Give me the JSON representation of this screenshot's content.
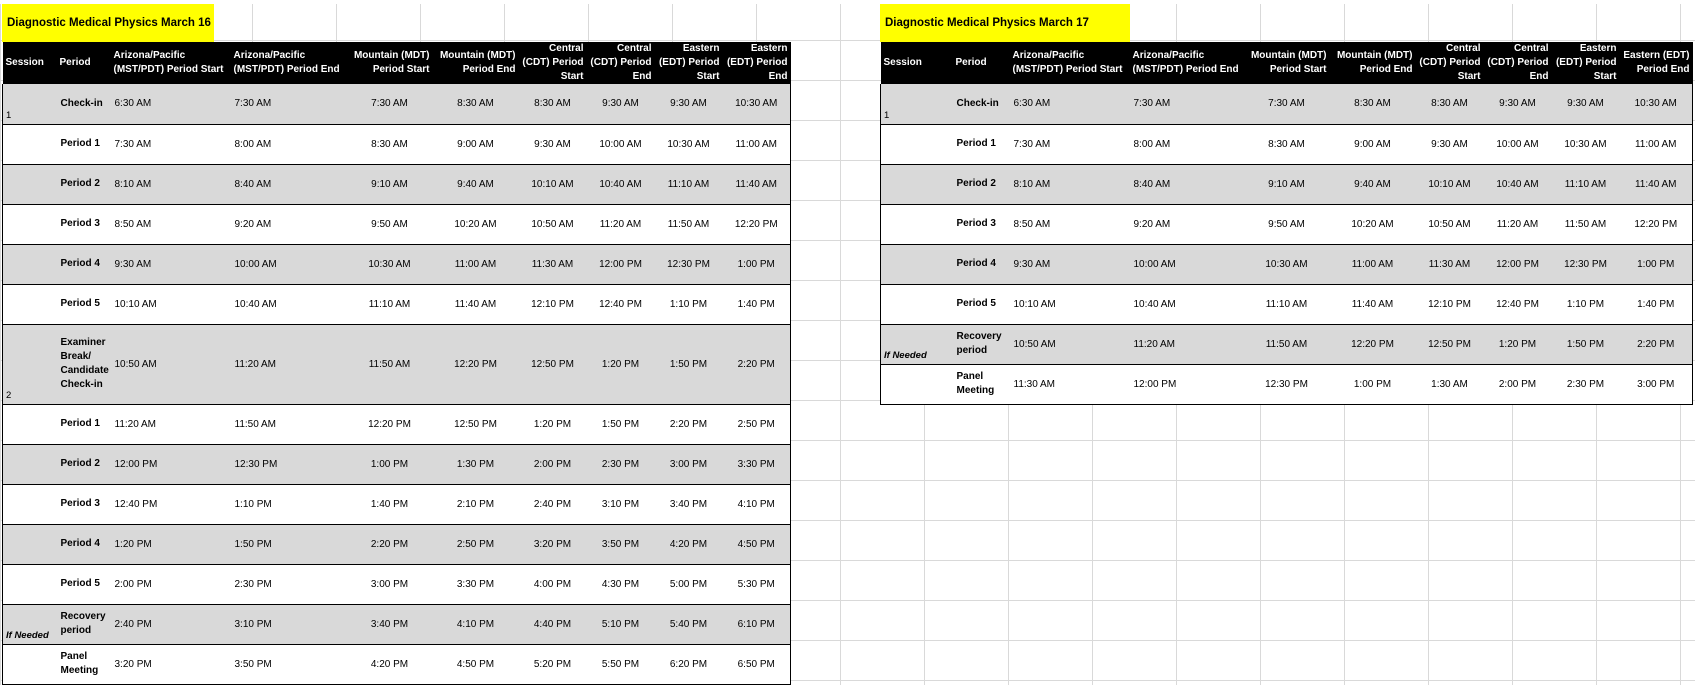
{
  "left": {
    "title": "Diagnostic Medical Physics March 16",
    "headers": [
      "Session",
      "Period",
      "Arizona/Pacific (MST/PDT) Period Start",
      "Arizona/Pacific (MST/PDT) Period End",
      "Mountain (MDT) Period Start",
      "Mountain (MDT) Period  End",
      "Central (CDT) Period Start",
      "Central (CDT) Period End",
      "Eastern (EDT) Period Start",
      "Eastern (EDT) Period End"
    ],
    "rows": [
      {
        "session": "1",
        "period": "Check-in",
        "times": [
          "6:30 AM",
          "7:30 AM",
          "7:30 AM",
          "8:30 AM",
          "8:30 AM",
          "9:30 AM",
          "9:30 AM",
          "10:30 AM"
        ]
      },
      {
        "session": "",
        "period": "Period 1",
        "times": [
          "7:30 AM",
          "8:00 AM",
          "8:30 AM",
          "9:00 AM",
          "9:30 AM",
          "10:00 AM",
          "10:30 AM",
          "11:00 AM"
        ]
      },
      {
        "session": "",
        "period": "Period 2",
        "times": [
          "8:10 AM",
          "8:40 AM",
          "9:10 AM",
          "9:40 AM",
          "10:10 AM",
          "10:40 AM",
          "11:10 AM",
          "11:40 AM"
        ]
      },
      {
        "session": "",
        "period": "Period 3",
        "times": [
          "8:50 AM",
          "9:20 AM",
          "9:50 AM",
          "10:20 AM",
          "10:50 AM",
          "11:20 AM",
          "11:50 AM",
          "12:20 PM"
        ]
      },
      {
        "session": "",
        "period": "Period 4",
        "times": [
          "9:30 AM",
          "10:00 AM",
          "10:30 AM",
          "11:00 AM",
          "11:30 AM",
          "12:00 PM",
          "12:30 PM",
          "1:00 PM"
        ]
      },
      {
        "session": "",
        "period": "Period 5",
        "times": [
          "10:10 AM",
          "10:40 AM",
          "11:10 AM",
          "11:40 AM",
          "12:10 PM",
          "12:40 PM",
          "1:10 PM",
          "1:40 PM"
        ]
      },
      {
        "session": "2",
        "period": "Examiner Break/ Candidate Check-in",
        "times": [
          "10:50 AM",
          "11:20 AM",
          "11:50 AM",
          "12:20 PM",
          "12:50 PM",
          "1:20 PM",
          "1:50 PM",
          "2:20 PM"
        ]
      },
      {
        "session": "",
        "period": "Period 1",
        "times": [
          "11:20 AM",
          "11:50 AM",
          "12:20 PM",
          "12:50 PM",
          "1:20 PM",
          "1:50 PM",
          "2:20 PM",
          "2:50 PM"
        ]
      },
      {
        "session": "",
        "period": "Period 2",
        "times": [
          "12:00 PM",
          "12:30 PM",
          "1:00 PM",
          "1:30 PM",
          "2:00 PM",
          "2:30 PM",
          "3:00 PM",
          "3:30 PM"
        ]
      },
      {
        "session": "",
        "period": "Period 3",
        "times": [
          "12:40 PM",
          "1:10 PM",
          "1:40 PM",
          "2:10 PM",
          "2:40 PM",
          "3:10 PM",
          "3:40 PM",
          "4:10 PM"
        ]
      },
      {
        "session": "",
        "period": "Period 4",
        "times": [
          "1:20 PM",
          "1:50 PM",
          "2:20 PM",
          "2:50 PM",
          "3:20 PM",
          "3:50 PM",
          "4:20 PM",
          "4:50 PM"
        ]
      },
      {
        "session": "",
        "period": "Period 5",
        "times": [
          "2:00 PM",
          "2:30 PM",
          "3:00 PM",
          "3:30 PM",
          "4:00 PM",
          "4:30 PM",
          "5:00 PM",
          "5:30 PM"
        ]
      },
      {
        "session": "If Needed",
        "period": "Recovery period",
        "times": [
          "2:40 PM",
          "3:10 PM",
          "3:40 PM",
          "4:10 PM",
          "4:40 PM",
          "5:10 PM",
          "5:40 PM",
          "6:10 PM"
        ]
      },
      {
        "session": "",
        "period": "Panel Meeting",
        "times": [
          "3:20 PM",
          "3:50 PM",
          "4:20 PM",
          "4:50 PM",
          "5:20 PM",
          "5:50 PM",
          "6:20 PM",
          "6:50 PM"
        ]
      }
    ]
  },
  "right": {
    "title": "Diagnostic Medical Physics March 17",
    "headers": [
      "Session",
      "Period",
      "Arizona/Pacific (MST/PDT) Period Start",
      "Arizona/Pacific (MST/PDT) Period End",
      "Mountain (MDT) Period Start",
      "Mountain (MDT) Period  End",
      "Central (CDT) Period Start",
      "Central (CDT) Period End",
      "Eastern (EDT) Period Start",
      "Eastern (EDT) Period End"
    ],
    "rows": [
      {
        "session": "1",
        "period": "Check-in",
        "times": [
          "6:30 AM",
          "7:30 AM",
          "7:30 AM",
          "8:30 AM",
          "8:30 AM",
          "9:30 AM",
          "9:30 AM",
          "10:30 AM"
        ]
      },
      {
        "session": "",
        "period": "Period 1",
        "times": [
          "7:30 AM",
          "8:00 AM",
          "8:30 AM",
          "9:00 AM",
          "9:30 AM",
          "10:00 AM",
          "10:30 AM",
          "11:00 AM"
        ]
      },
      {
        "session": "",
        "period": "Period 2",
        "times": [
          "8:10 AM",
          "8:40 AM",
          "9:10 AM",
          "9:40 AM",
          "10:10 AM",
          "10:40 AM",
          "11:10 AM",
          "11:40 AM"
        ]
      },
      {
        "session": "",
        "period": "Period 3",
        "times": [
          "8:50 AM",
          "9:20 AM",
          "9:50 AM",
          "10:20 AM",
          "10:50 AM",
          "11:20 AM",
          "11:50 AM",
          "12:20 PM"
        ]
      },
      {
        "session": "",
        "period": "Period 4",
        "times": [
          "9:30 AM",
          "10:00 AM",
          "10:30 AM",
          "11:00 AM",
          "11:30 AM",
          "12:00 PM",
          "12:30 PM",
          "1:00 PM"
        ]
      },
      {
        "session": "",
        "period": "Period 5",
        "times": [
          "10:10 AM",
          "10:40 AM",
          "11:10 AM",
          "11:40 AM",
          "12:10 PM",
          "12:40 PM",
          "1:10 PM",
          "1:40 PM"
        ]
      },
      {
        "session": "If Needed",
        "period": "Recovery period",
        "times": [
          "10:50 AM",
          "11:20 AM",
          "11:50 AM",
          "12:20 PM",
          "12:50 PM",
          "1:20 PM",
          "1:50 PM",
          "2:20 PM"
        ]
      },
      {
        "session": "",
        "period": "Panel Meeting",
        "times": [
          "11:30 AM",
          "12:00 PM",
          "12:30 PM",
          "1:00 PM",
          "1:30 AM",
          "2:00 PM",
          "2:30 PM",
          "3:00 PM"
        ]
      }
    ]
  },
  "colors": {
    "title_bg": "#ffff00",
    "header_bg": "#000000",
    "shaded_row": "#d9d9d9",
    "gridline": "#d9d9d9"
  }
}
